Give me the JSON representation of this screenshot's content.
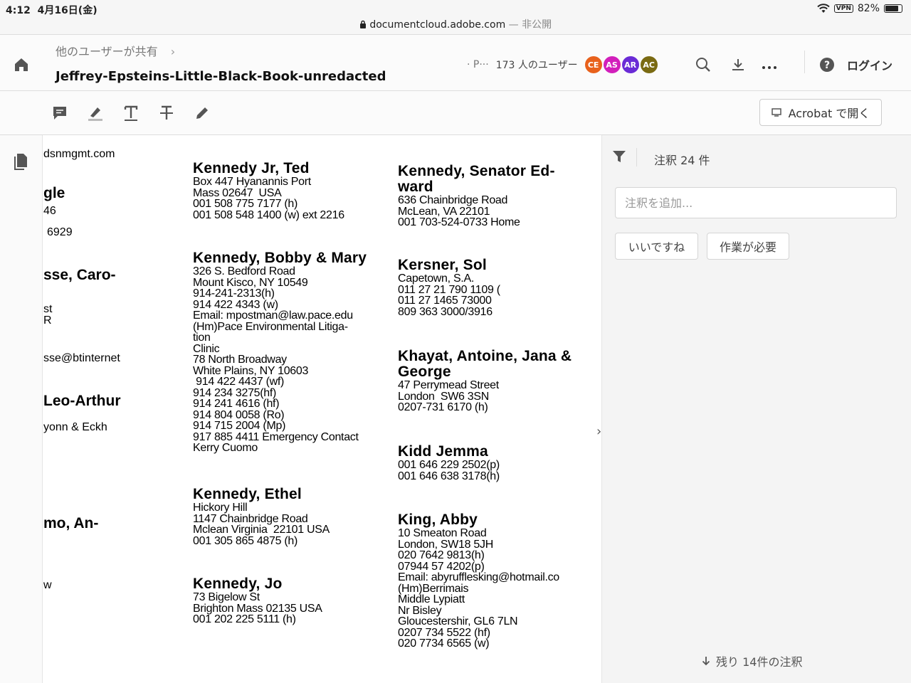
{
  "status_bar": {
    "time": "4:12",
    "date": "4月16日(金)",
    "vpn": "VPN",
    "battery": "82%",
    "battery_level": 0.82
  },
  "address_bar": {
    "domain": "documentcloud.adobe.com",
    "visibility": "— 非公開"
  },
  "header": {
    "breadcrumb": "他のユーザーが共有",
    "title": "Jeffrey-Epsteins-Little-Black-Book-unredacted",
    "presence_truncated": "· P···",
    "user_count": "173 人のユーザー",
    "avatars": [
      {
        "initials": "CE",
        "color": "#e8611c"
      },
      {
        "initials": "AS",
        "color": "#d21fbb"
      },
      {
        "initials": "AR",
        "color": "#6a2bd6"
      },
      {
        "initials": "AC",
        "color": "#7a6a12"
      }
    ],
    "login_label": "ログイン"
  },
  "toolbar": {
    "tools": [
      "comment-icon",
      "highlight-icon",
      "add-text-icon",
      "strikethrough-icon",
      "draw-icon"
    ],
    "open_acrobat_label": "Acrobat で開く"
  },
  "document": {
    "left_fragments": [
      "dsnmgmt.com",
      "gle",
      "46",
      "6929",
      "sse, Caro-",
      "st",
      "R",
      "sse@btinternet",
      "Leo-Arthur",
      "yonn & Eckh",
      "mo, An-",
      "w"
    ],
    "column_middle": [
      {
        "name": "Kennedy Jr, Ted",
        "lines": [
          "Box 447 Hyanannis Port",
          "Mass 02647  USA",
          "001 508 775 7177 (h)",
          "001 508 548 1400 (w) ext 2216"
        ]
      },
      {
        "name": "Kennedy, Bobby & Mary",
        "lines": [
          "326 S. Bedford Road",
          "Mount Kisco, NY 10549",
          "914-241-2313(h)",
          "914 422 4343 (w)",
          "Email: mpostman@law.pace.edu",
          "(Hm)Pace Environmental Litiga-",
          "tion",
          "Clinic",
          "78 North Broadway",
          "White Plains, NY 10603",
          " 914 422 4437 (wf)",
          "914 234 3275(hf)",
          "914 241 4616 (hf)",
          "914 804 0058 (Ro)",
          "914 715 2004 (Mp)",
          "917 885 4411 Emergency Contact",
          "Kerry Cuomo"
        ]
      },
      {
        "name": "Kennedy, Ethel",
        "lines": [
          "Hickory Hill",
          "1147 Chainbridge Road",
          "Mclean Virginia  22101 USA",
          "001 305 865 4875 (h)"
        ]
      },
      {
        "name": "Kennedy, Jo",
        "lines": [
          "73 Bigelow St",
          "Brighton Mass 02135 USA",
          "001 202 225 5111 (h)"
        ]
      }
    ],
    "column_right": [
      {
        "name": "Kennedy, Senator Ed-\nward",
        "lines": [
          "636 Chainbridge Road",
          "McLean, VA 22101",
          "001 703-524-0733 Home"
        ]
      },
      {
        "name": "Kersner, Sol",
        "lines": [
          "Capetown, S.A.",
          "011 27 21 790 1109 (",
          "011 27 1465 73000",
          "809 363 3000/3916"
        ]
      },
      {
        "name": "Khayat, Antoine, Jana &\nGeorge",
        "lines": [
          "47 Perrymead Street",
          "London  SW6 3SN",
          "0207-731 6170 (h)"
        ]
      },
      {
        "name": "Kidd Jemma",
        "lines": [
          "001 646 229 2502(p)",
          "001 646 638 3178(h)"
        ]
      },
      {
        "name": "King, Abby",
        "lines": [
          "10 Smeaton Road",
          "London, SW18 5JH",
          "020 7642 9813(h)",
          "07944 57 4202(p)",
          "Email: abyrufflesking@hotmail.co",
          "(Hm)Berrimais",
          "Middle Lypiatt",
          "Nr Bisley",
          "Gloucestershir, GL6 7LN",
          "0207 734 5522 (hf)",
          "020 7734 6565 (w)"
        ]
      }
    ]
  },
  "comments_panel": {
    "count_label": "注釈 24 件",
    "input_placeholder": "注釈を追加...",
    "like_label": "いいですね",
    "needs_work_label": "作業が必要",
    "remaining_label": "残り 14件の注釈"
  }
}
